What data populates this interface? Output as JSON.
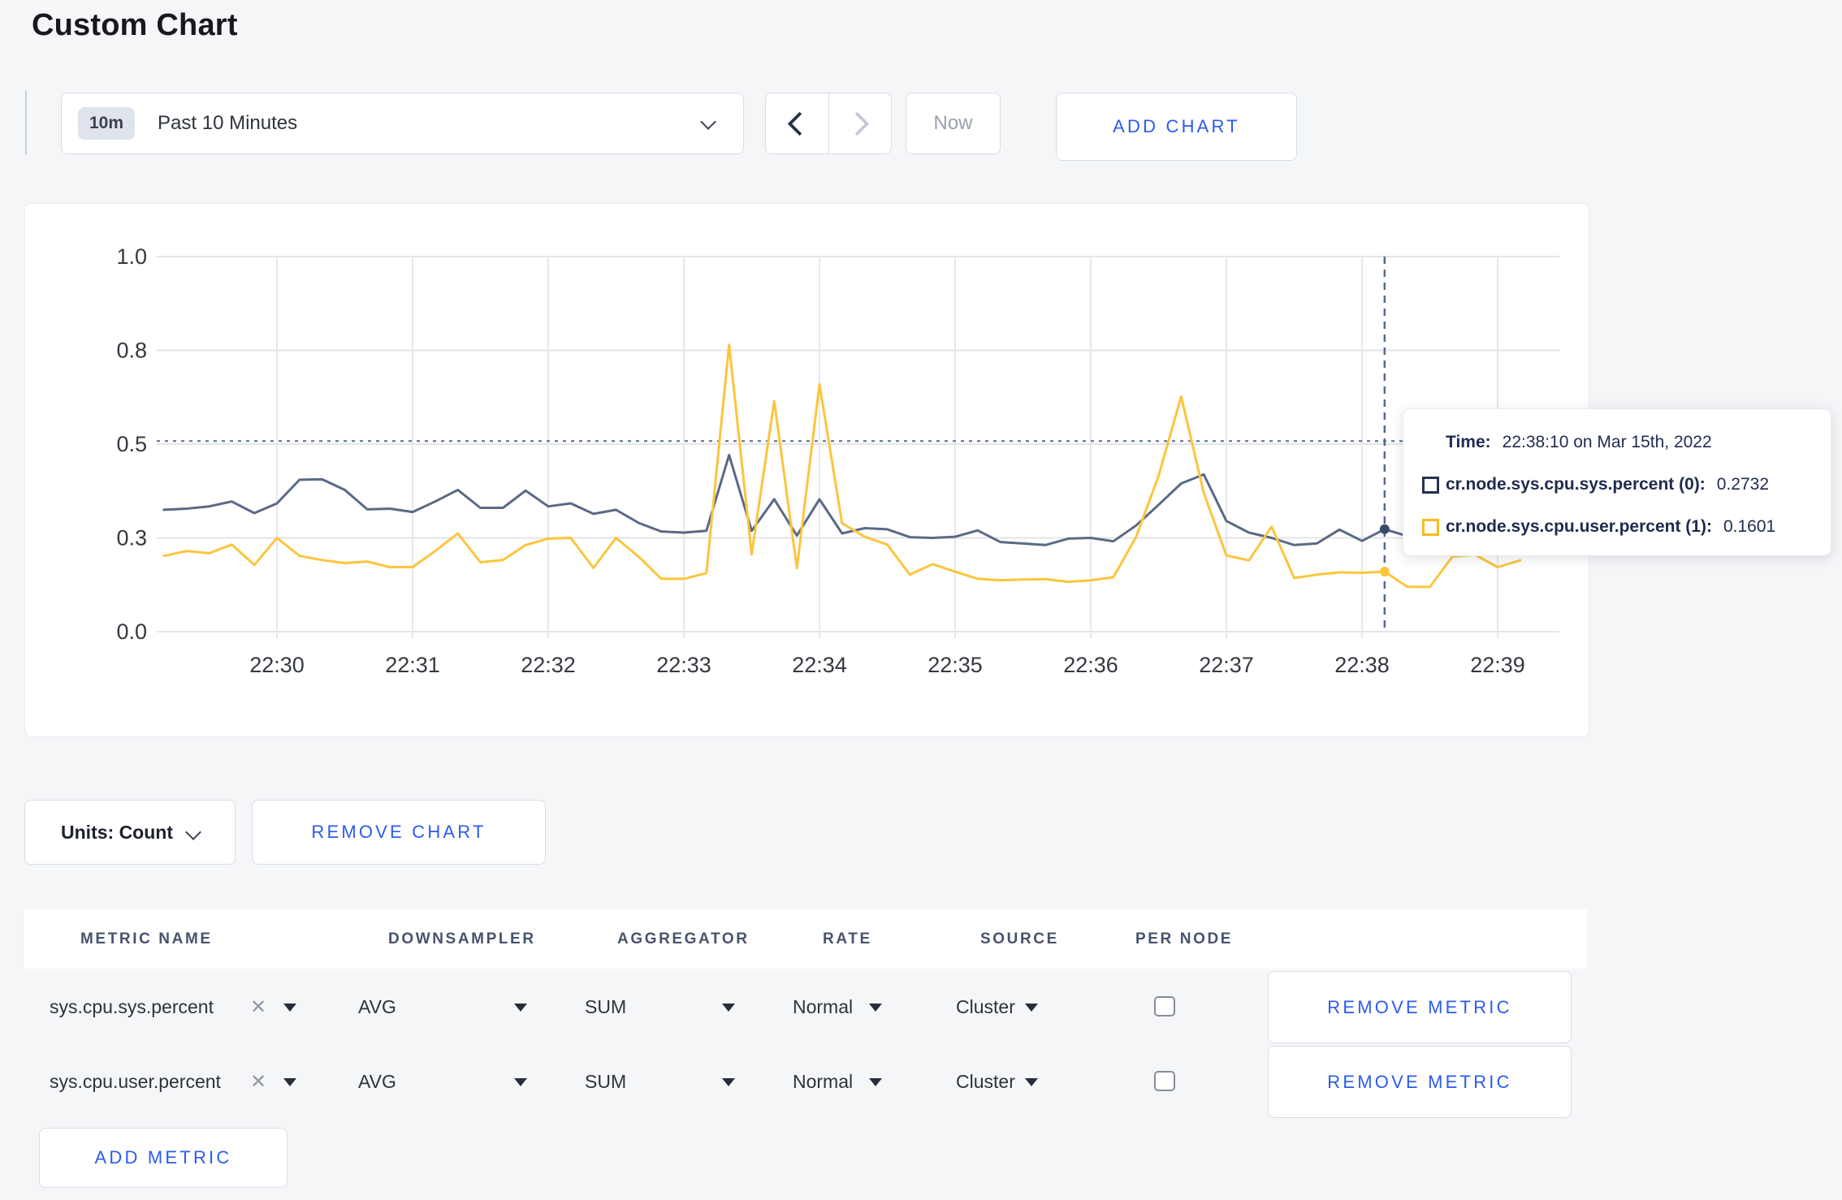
{
  "page": {
    "title": "Custom Chart"
  },
  "toolbar": {
    "time_range": {
      "badge": "10m",
      "label": "Past 10 Minutes"
    },
    "now_label": "Now",
    "add_chart_label": "ADD CHART"
  },
  "tooltip": {
    "time_label": "Time:",
    "time_value": "22:38:10 on Mar 15th, 2022",
    "series": [
      {
        "label": "cr.node.sys.cpu.sys.percent (0):",
        "value": "0.2732",
        "icon_color": "#26324f"
      },
      {
        "label": "cr.node.sys.cpu.user.percent (1):",
        "value": "0.1601",
        "icon_color": "#f7bd1e"
      }
    ]
  },
  "chart_controls": {
    "units_label": "Units: Count",
    "remove_chart_label": "REMOVE CHART"
  },
  "metrics_table": {
    "headers": [
      "METRIC NAME",
      "DOWNSAMPLER",
      "AGGREGATOR",
      "RATE",
      "SOURCE",
      "PER NODE"
    ],
    "rows": [
      {
        "metric": "sys.cpu.sys.percent",
        "downsampler": "AVG",
        "aggregator": "SUM",
        "rate": "Normal",
        "source": "Cluster",
        "per_node_checked": false,
        "remove_label": "REMOVE METRIC"
      },
      {
        "metric": "sys.cpu.user.percent",
        "downsampler": "AVG",
        "aggregator": "SUM",
        "rate": "Normal",
        "source": "Cluster",
        "per_node_checked": false,
        "remove_label": "REMOVE METRIC"
      }
    ],
    "add_metric_label": "ADD METRIC"
  },
  "chart_data": {
    "type": "line",
    "title": "",
    "xlabel": "",
    "ylabel": "",
    "ylim": [
      0,
      1
    ],
    "grid": true,
    "x_start_time": "22:29:10",
    "x_step_seconds": 10,
    "x_tick_labels": [
      "22:30",
      "22:31",
      "22:32",
      "22:33",
      "22:34",
      "22:35",
      "22:36",
      "22:37",
      "22:38",
      "22:39"
    ],
    "y_tick_labels": [
      "0.0",
      "0.3",
      "0.5",
      "0.8",
      "1.0"
    ],
    "y_tick_values": [
      0,
      0.25,
      0.5,
      0.75,
      1.0
    ],
    "series": [
      {
        "name": "cr.node.sys.cpu.sys.percent",
        "color": "#5a6a84",
        "dot_color": "#3b4a6b",
        "values": [
          0.325,
          0.328,
          0.334,
          0.347,
          0.316,
          0.342,
          0.405,
          0.406,
          0.378,
          0.326,
          0.328,
          0.319,
          0.347,
          0.378,
          0.33,
          0.33,
          0.376,
          0.334,
          0.342,
          0.314,
          0.325,
          0.29,
          0.267,
          0.264,
          0.269,
          0.471,
          0.269,
          0.353,
          0.256,
          0.353,
          0.262,
          0.276,
          0.273,
          0.252,
          0.25,
          0.253,
          0.27,
          0.239,
          0.235,
          0.231,
          0.248,
          0.25,
          0.241,
          0.283,
          0.338,
          0.395,
          0.419,
          0.295,
          0.264,
          0.25,
          0.231,
          0.235,
          0.272,
          0.242,
          0.2732,
          0.255,
          0.248,
          0.252,
          0.26,
          0.27,
          0.3
        ]
      },
      {
        "name": "cr.node.sys.cpu.user.percent",
        "color": "#fcc53d",
        "dot_color": "#fcc53d",
        "values": [
          0.202,
          0.215,
          0.209,
          0.232,
          0.178,
          0.25,
          0.202,
          0.191,
          0.183,
          0.187,
          0.172,
          0.172,
          0.215,
          0.262,
          0.185,
          0.191,
          0.231,
          0.248,
          0.25,
          0.17,
          0.25,
          0.2,
          0.141,
          0.141,
          0.156,
          0.765,
          0.206,
          0.615,
          0.169,
          0.66,
          0.289,
          0.253,
          0.232,
          0.152,
          0.18,
          0.16,
          0.141,
          0.137,
          0.139,
          0.14,
          0.133,
          0.137,
          0.145,
          0.252,
          0.415,
          0.627,
          0.37,
          0.203,
          0.19,
          0.28,
          0.143,
          0.152,
          0.158,
          0.157,
          0.1601,
          0.12,
          0.119,
          0.2,
          0.205,
          0.172,
          0.19
        ]
      }
    ],
    "crosshair": {
      "time": "22:38:10",
      "x_index": 54,
      "y_value": 0.508,
      "point_values": [
        0.2732,
        0.1601
      ]
    },
    "legend_position": "tooltip"
  }
}
